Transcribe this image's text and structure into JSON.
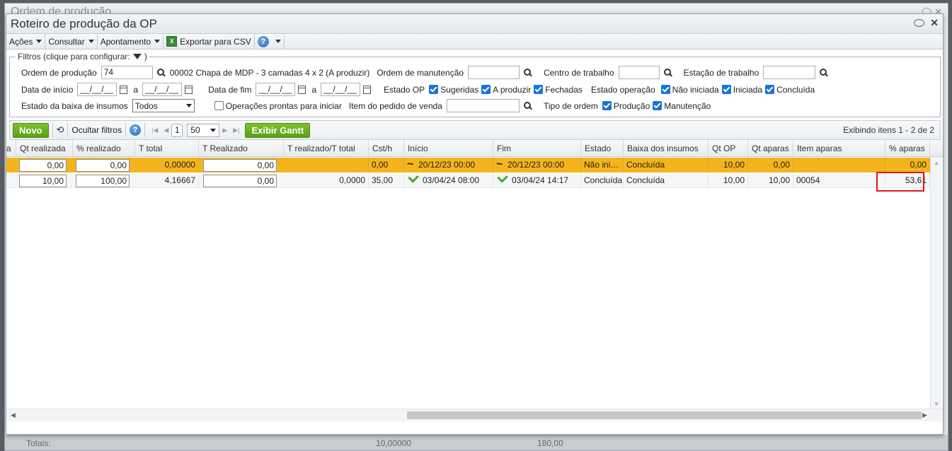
{
  "background_window": {
    "title": "Ordem de produção",
    "totals_label": "Totais:",
    "totals_values": [
      "10,00000",
      "180,00"
    ]
  },
  "window": {
    "title": "Roteiro de produção da OP"
  },
  "menubar": {
    "items": [
      "Ações",
      "Consultar",
      "Apontamento"
    ],
    "export_label": "Exportar para CSV",
    "help": "?"
  },
  "filters": {
    "legend": "Filtros (clique para configurar:",
    "legend_close": ")",
    "ordem_producao": {
      "label": "Ordem de produção",
      "value": "74",
      "desc": "00002 Chapa de MDP - 3 camadas 4 x 2 (A produzir)"
    },
    "ordem_manutencao": {
      "label": "Ordem de manutenção",
      "value": ""
    },
    "centro_trabalho": {
      "label": "Centro de trabalho",
      "value": ""
    },
    "estacao_trabalho": {
      "label": "Estação de trabalho",
      "value": ""
    },
    "data_inicio": {
      "label": "Data de início",
      "from": "__/__/__",
      "sep": "a",
      "to": "__/__/__"
    },
    "data_fim": {
      "label": "Data de fim",
      "from": "__/__/__",
      "sep": "a",
      "to": "__/__/__"
    },
    "estado_op": {
      "label": "Estado OP",
      "options": [
        {
          "label": "Sugeridas",
          "checked": true
        },
        {
          "label": "A produzir",
          "checked": true
        },
        {
          "label": "Fechadas",
          "checked": true
        }
      ]
    },
    "estado_operacao": {
      "label": "Estado operação",
      "options": [
        {
          "label": "Não iniciada",
          "checked": true
        },
        {
          "label": "Iniciada",
          "checked": true
        },
        {
          "label": "Concluída",
          "checked": true
        }
      ]
    },
    "estado_baixa": {
      "label": "Estado da baixa de insumos",
      "value": "Todos"
    },
    "operacoes_prontas": {
      "label": "Operações prontas para iniciar",
      "checked": false
    },
    "item_pedido": {
      "label": "Item do pedido de venda",
      "value": ""
    },
    "tipo_ordem": {
      "label": "Tipo de ordem",
      "options": [
        {
          "label": "Produção",
          "checked": true
        },
        {
          "label": "Manutenção",
          "checked": true
        }
      ]
    }
  },
  "toolbar": {
    "new_label": "Novo",
    "hide_filters_label": "Ocultar filtros",
    "help": "?",
    "page": "1",
    "page_size": "50",
    "gantt_label": "Exibir Gantt",
    "showing": "Exibindo itens 1 - 2 de 2"
  },
  "grid": {
    "columns": [
      "a",
      "Qt realizada",
      "% realizado",
      "T total",
      "T Realizado",
      "T realizado/T total",
      "Cst/h",
      "Início",
      "Fim",
      "Estado",
      "Baixa dos insumos",
      "Qt OP",
      "Qt aparas",
      "Item aparas",
      "% aparas"
    ],
    "rows": [
      {
        "qt_realizada": "0,00",
        "pct_realizado": "0,00",
        "t_total": "0,00000",
        "t_realizado": "0,00",
        "t_ratio": "",
        "cst_h": "0,00",
        "inicio": "20/12/23 00:00",
        "fim": "20/12/23 00:00",
        "estado": "Não iniciada",
        "baixa": "Concluída",
        "qt_op": "10,00",
        "qt_aparas": "0,00",
        "item_aparas": "",
        "pct_aparas": "0,00"
      },
      {
        "qt_realizada": "10,00",
        "pct_realizado": "100,00",
        "t_total": "4,16667",
        "t_realizado": "0,00",
        "t_ratio": "0,0000",
        "cst_h": "35,00",
        "inicio": "03/04/24 08:00",
        "fim": "03/04/24 14:17",
        "estado": "Concluída",
        "baixa": "Concluída",
        "qt_op": "10,00",
        "qt_aparas": "10,00",
        "item_aparas": "00054",
        "pct_aparas": "53,61"
      }
    ]
  },
  "colors": {
    "highlight_row": "#f4b41c",
    "accent_green": "#5aa01a",
    "checkbox_blue": "#1a73d9",
    "annotation_red": "#e3141c"
  }
}
